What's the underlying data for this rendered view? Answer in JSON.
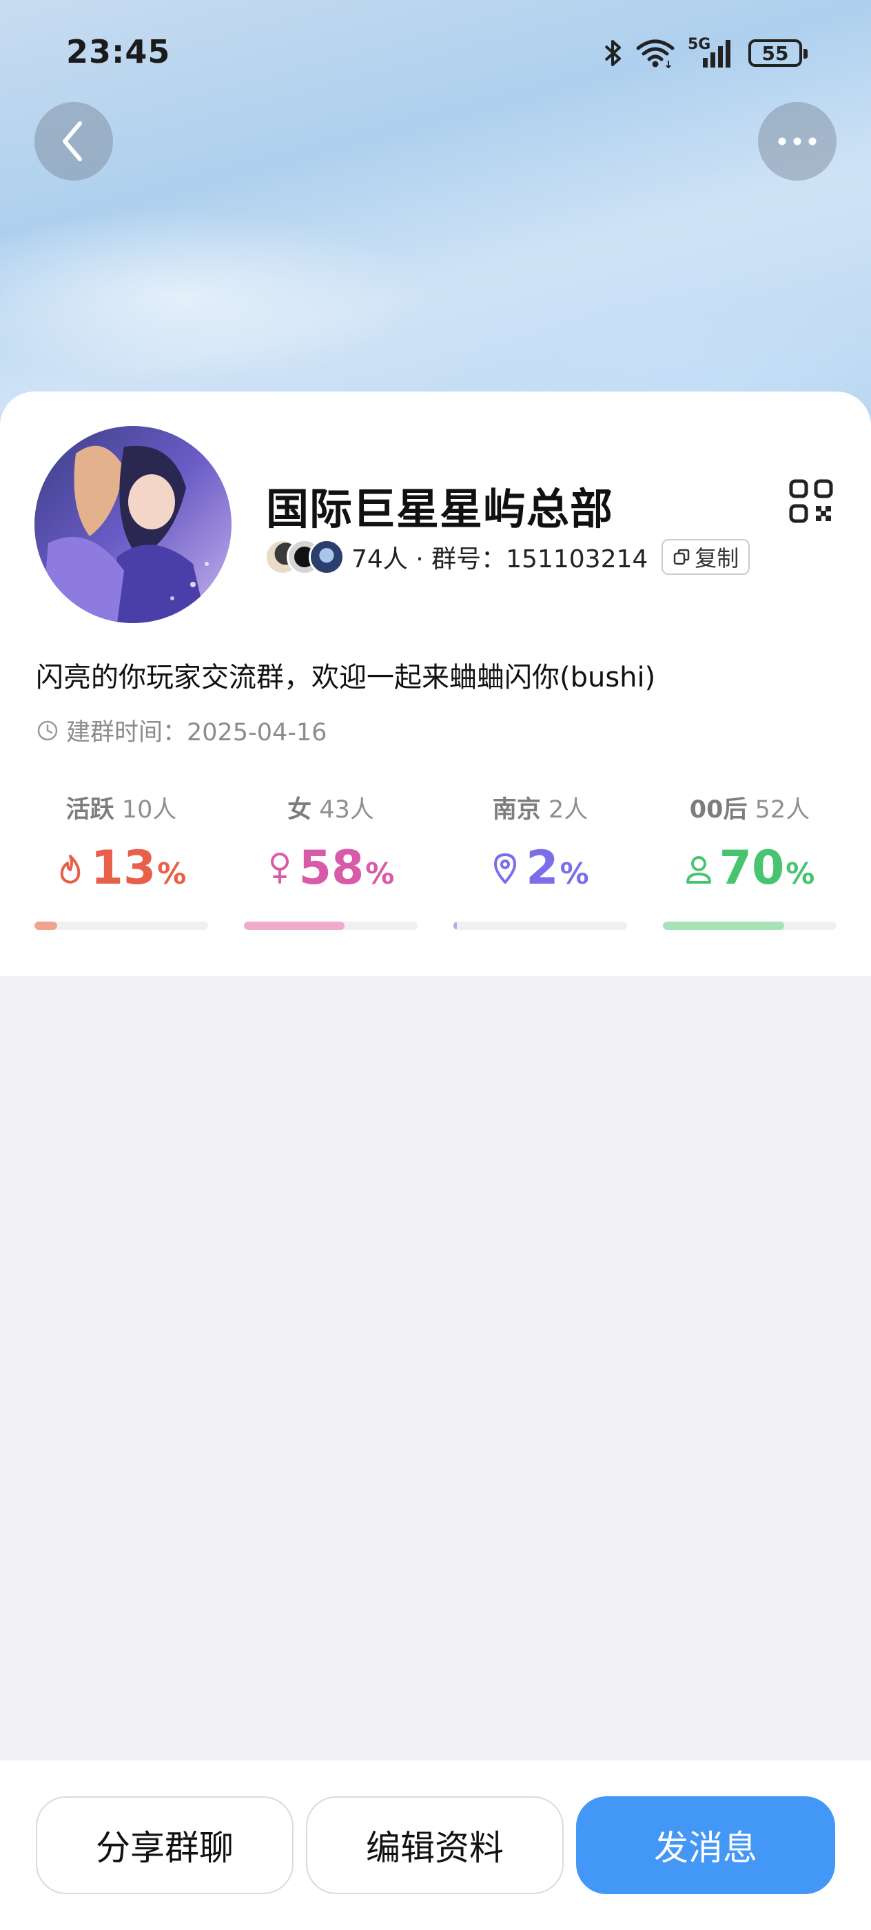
{
  "status_bar": {
    "time": "23:45",
    "network": "5G",
    "battery": "55",
    "icons": [
      "bluetooth-icon",
      "wifi-icon",
      "signal-icon",
      "battery-icon"
    ]
  },
  "header": {
    "back_icon": "chevron-left-icon",
    "more_icon": "more-dots-icon"
  },
  "group": {
    "name": "国际巨星星屿总部",
    "meta": "74人 · 群号：151103214",
    "copy_label": "复制",
    "description": "闪亮的你玩家交流群，欢迎一起来蛐蛐闪你(bushi)",
    "created": "建群时间：2025-04-16"
  },
  "stats": [
    {
      "label": "活跃",
      "count": "10人",
      "value": "13",
      "unit": "%",
      "percent": 13,
      "color": "#e8604a",
      "bar_color": "#f2a38f",
      "icon": "flame-icon"
    },
    {
      "label": "女",
      "count": "43人",
      "value": "58",
      "unit": "%",
      "percent": 58,
      "color": "#d95aa8",
      "bar_color": "#f0aacd",
      "icon": "female-icon"
    },
    {
      "label": "南京",
      "count": "2人",
      "value": "2",
      "unit": "%",
      "percent": 2,
      "color": "#7b6ee8",
      "bar_color": "#b3abf2",
      "icon": "location-pin-icon"
    },
    {
      "label": "00后",
      "count": "52人",
      "value": "70",
      "unit": "%",
      "percent": 70,
      "color": "#46c46e",
      "bar_color": "#a7e2b9",
      "icon": "person-icon"
    }
  ],
  "actions": {
    "share": "分享群聊",
    "edit": "编辑资料",
    "send": "发消息"
  },
  "colors": {
    "primary": "#4397f7",
    "page_bg": "#f1f1f6"
  }
}
